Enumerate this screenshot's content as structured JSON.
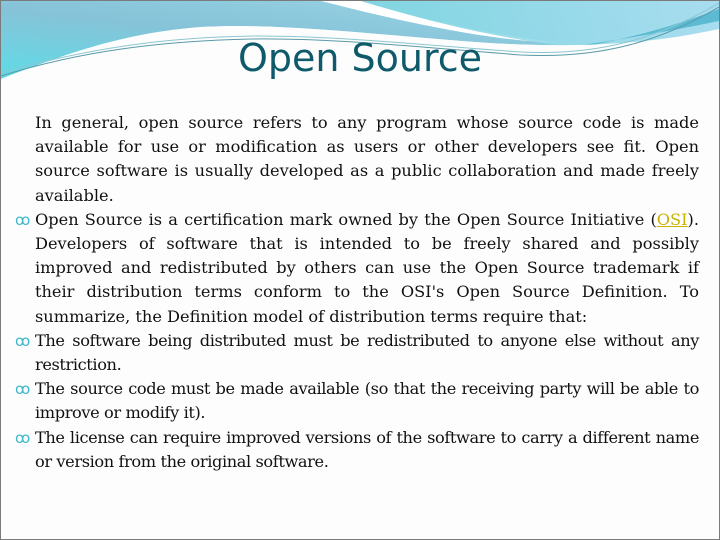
{
  "slide": {
    "title": "Open Source",
    "bullet_icon": "curl-bullet-icon",
    "colors": {
      "title": "#0e5a6b",
      "bullet": "#3fb8c8",
      "link": "#c8b400",
      "wave_light": "#8fd3e0",
      "wave_dark": "#4fb5cc"
    },
    "paragraphs": [
      {
        "bullet": false,
        "text": "In general, open source refers to any program whose source code is made available for use or modification as users or other developers see fit. Open source software is usually developed as a public collaboration and made freely available."
      },
      {
        "bullet": true,
        "text_before": "Open Source is a certification mark owned by the Open Source Initiative (",
        "link_text": "OSI",
        "text_after": "). Developers of software that is intended to be freely shared and possibly improved and redistributed by others can use the Open Source trademark if their distribution terms conform to the OSI's Open Source Definition. To summarize, the Definition model of distribution terms require that:"
      },
      {
        "bullet": true,
        "text": "The software being distributed must be redistributed to anyone else without any restriction."
      },
      {
        "bullet": true,
        "text": "The source code must be made available (so that the receiving party will be able to improve or modify it)."
      },
      {
        "bullet": true,
        "text": "The license can require improved versions of the software to carry a different name or version from the original software."
      }
    ]
  }
}
